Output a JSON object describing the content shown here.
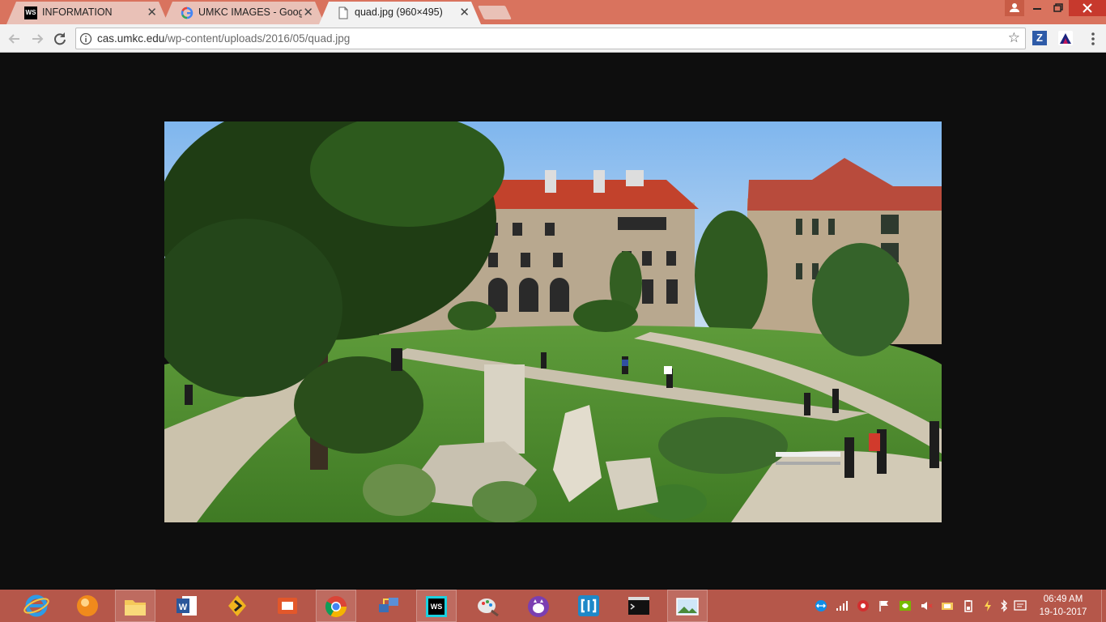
{
  "tabs": [
    {
      "label": "INFORMATION",
      "icon": "webstorm-icon"
    },
    {
      "label": "UMKC IMAGES - Google",
      "icon": "google-icon"
    },
    {
      "label": "quad.jpg (960×495)",
      "icon": "document-icon",
      "active": true
    }
  ],
  "tab_close_glyph": "✕",
  "address": {
    "host": "cas.umkc.edu",
    "path": "/wp-content/uploads/2016/05/quad.jpg"
  },
  "extensions": [
    {
      "label": "Z",
      "icon": "zotero-icon"
    },
    {
      "label": "",
      "icon": "tampermonkey-icon"
    }
  ],
  "clock": {
    "time": "06:49 AM",
    "date": "19-10-2017"
  },
  "colors": {
    "titlebar": "#d9735e",
    "taskbar": "#b5574a",
    "close_button": "#c7392d"
  },
  "taskbar_apps": [
    "internet-explorer-icon",
    "vlc-icon",
    "file-explorer-icon",
    "word-icon",
    "winamp-icon",
    "pdf-icon",
    "chrome-icon",
    "network-icon",
    "webstorm-icon",
    "paint-icon",
    "cat-icon",
    "bracket-icon",
    "cmd-icon",
    "photos-icon"
  ]
}
